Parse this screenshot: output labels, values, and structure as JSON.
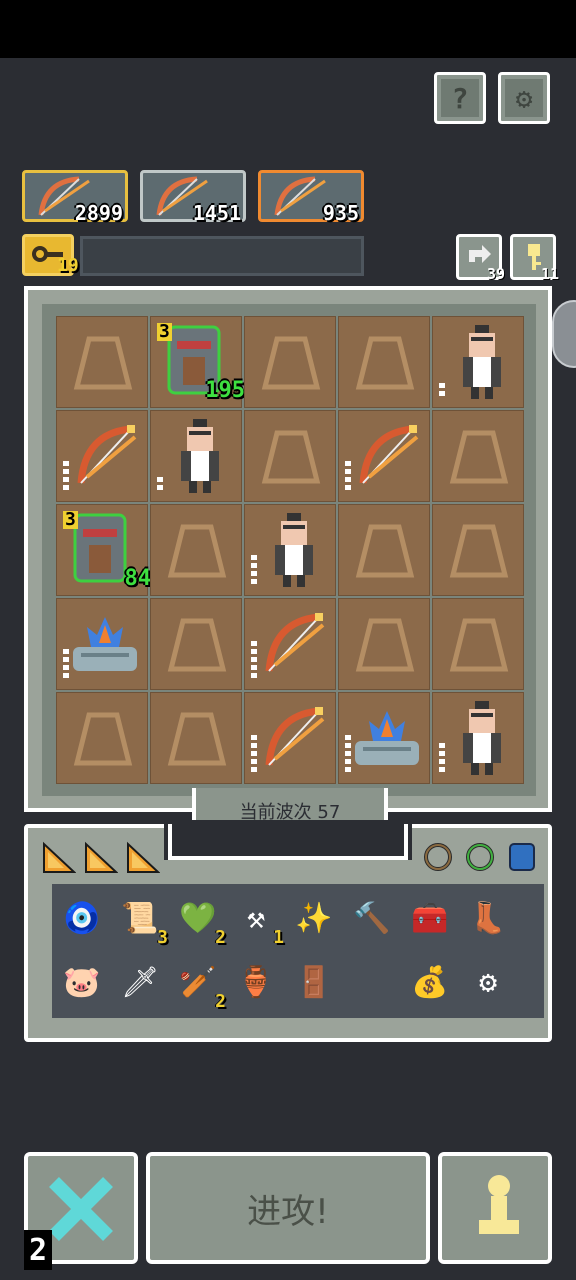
{
  "header": {
    "help_icon": "question-icon",
    "settings_icon": "gear-icon"
  },
  "resources": [
    {
      "name": "bow-resource-1",
      "value": "2899",
      "border": "#e8c040"
    },
    {
      "name": "bow-resource-2",
      "value": "1451",
      "border": "#c0c8c8"
    },
    {
      "name": "bow-resource-3",
      "value": "935",
      "border": "#f08a30"
    }
  ],
  "experience": {
    "icon": "key-icon",
    "level": "19"
  },
  "side_buttons": {
    "recycle_count": "39",
    "key_count": "11"
  },
  "board": {
    "wave_label": "当前波次 57",
    "units": [
      {
        "row": 0,
        "col": 1,
        "type": "shield",
        "level": "3",
        "hp": "195"
      },
      {
        "row": 0,
        "col": 4,
        "type": "soldier",
        "bars": 2
      },
      {
        "row": 1,
        "col": 0,
        "type": "bow",
        "bars": 4
      },
      {
        "row": 1,
        "col": 1,
        "type": "soldier",
        "bars": 2
      },
      {
        "row": 1,
        "col": 3,
        "type": "bow",
        "bars": 4
      },
      {
        "row": 2,
        "col": 0,
        "type": "shield",
        "level": "3",
        "hp": "84"
      },
      {
        "row": 2,
        "col": 2,
        "type": "soldier",
        "bars": 4
      },
      {
        "row": 3,
        "col": 0,
        "type": "fire",
        "bars": 4
      },
      {
        "row": 3,
        "col": 2,
        "type": "bow",
        "bars": 5
      },
      {
        "row": 4,
        "col": 2,
        "type": "bow",
        "bars": 5
      },
      {
        "row": 4,
        "col": 3,
        "type": "fire",
        "bars": 5
      },
      {
        "row": 4,
        "col": 4,
        "type": "soldier",
        "bars": 4
      }
    ]
  },
  "inventory": {
    "row1": [
      {
        "name": "blue-amulet-icon",
        "glyph": "🧿",
        "count": ""
      },
      {
        "name": "scroll-icon",
        "glyph": "📜",
        "count": "3"
      },
      {
        "name": "green-gem-icon",
        "glyph": "💚",
        "count": "2"
      },
      {
        "name": "anvil-icon",
        "glyph": "⚒",
        "count": "1"
      },
      {
        "name": "wand-icon",
        "glyph": "✨",
        "count": ""
      },
      {
        "name": "hammer-icon",
        "glyph": "🔨",
        "count": ""
      },
      {
        "name": "chest-icon",
        "glyph": "🧰",
        "count": ""
      },
      {
        "name": "boot-icon",
        "glyph": "👢",
        "count": ""
      }
    ],
    "row2": [
      {
        "name": "pig-icon",
        "glyph": "🐷",
        "count": ""
      },
      {
        "name": "sword-icon",
        "glyph": "🗡",
        "count": ""
      },
      {
        "name": "club-icon",
        "glyph": "🏏",
        "count": "2"
      },
      {
        "name": "vase-icon",
        "glyph": "🏺",
        "count": ""
      },
      {
        "name": "portal-icon",
        "glyph": "🚪",
        "count": ""
      },
      {
        "name": "empty",
        "glyph": "",
        "count": ""
      },
      {
        "name": "bag-icon",
        "glyph": "💰",
        "count": ""
      },
      {
        "name": "gear-token-icon",
        "glyph": "⚙",
        "count": ""
      }
    ]
  },
  "bottom": {
    "attack_label": "进攻!",
    "corner_number": "2",
    "colors": {
      "cancel_x": "#5fd8d8",
      "pawn": "#f8e898"
    }
  }
}
